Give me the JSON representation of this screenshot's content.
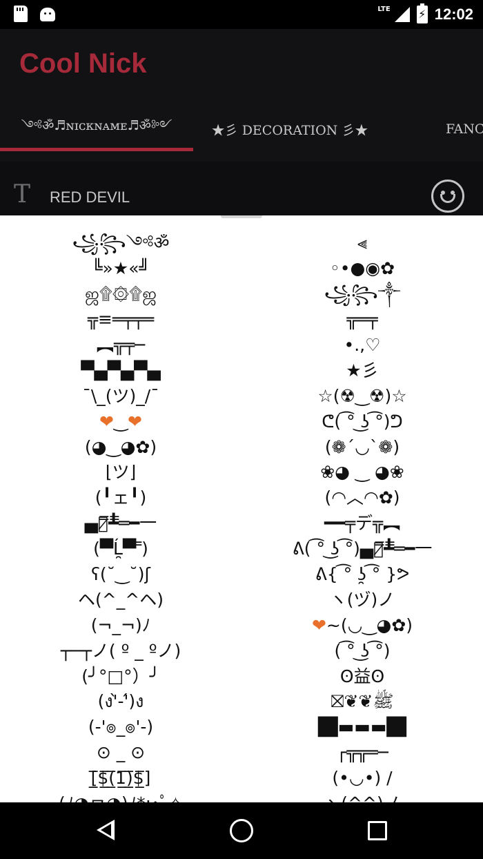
{
  "status_bar": {
    "network_label": "LTE",
    "battery_glyph": "⚡",
    "time": "12:02"
  },
  "app": {
    "title": "Cool Nick",
    "accent_color": "#a62a3a"
  },
  "tabs": [
    {
      "label": "༺ॐ♬ɴɪᴄᴋɴᴀᴍᴇ♬ॐ༻",
      "selected": true
    },
    {
      "label": "★彡 DECORATION 彡★",
      "selected": false
    },
    {
      "label": "FANCY",
      "selected": false
    }
  ],
  "input": {
    "icon_glyph": "T",
    "value": "RED DEVIL"
  },
  "list": {
    "left": [
      "꧁꧂༺ॐ",
      "╚»★«╝",
      "ஜ۩۞۩ஜ",
      "╦≡═╤╤═",
      "︻╦╤─",
      "▀▄▀▄▀▄",
      "¯\\_(ツ)_/¯",
      "❤‿❤",
      "(◕‿◕✿)",
      "⌊ツ⌋",
      "(╹ェ╹)",
      "▄︻̷̿┻̿═━一",
      "(▀̿Ĺ̯▀̿ ̿)",
      "ʕ(˘‿˘)ʃ",
      "ヘ(^_^ヘ)",
      "(¬_¬)ﾉ",
      "┬─┬ノ( º _ ºノ)",
      "(╯°□°）╯",
      "(ง'̀-'́)ง",
      "(-'๏_๏'-)",
      "⊙ _ ⊙",
      "[̲̅$̲̅(̲̅1̲̅)̲̅$̲̅]",
      "(ﾉ◕ヮ◕)ﾉ*:･ﾟ✧"
    ],
    "right": [
      "⫷",
      "◦•●◉✿",
      "꧁꧂༒",
      "╦═╤",
      "•.,♡",
      "★彡",
      "☆(☢‿☢)☆",
      "ᕦ( ͡° ͜ʖ ͡°)ᕤ",
      "(❁´◡`❁)",
      "❀◕ ‿ ◕❀",
      "(◠︿◠✿)",
      "━━╤デ╦︻",
      "ᕕ( ͡° ͜ʖ ͡°)▄︻̷̿┻̿═━一",
      "ᕕ{ ͡° ʖ̯ ͡° }ᕗ",
      "ヽ(ヅ)ノ",
      "❤~(◡‿◕✿)",
      "( ͡° ͜ʖ ͡°)",
      "ʘ益ʘ",
      "⛝❦❦ﷺ",
      "▐█▬▬▬█▌",
      "┌╦╦═─",
      "(•◡•) /",
      "ヽ(^^)ノ"
    ]
  }
}
